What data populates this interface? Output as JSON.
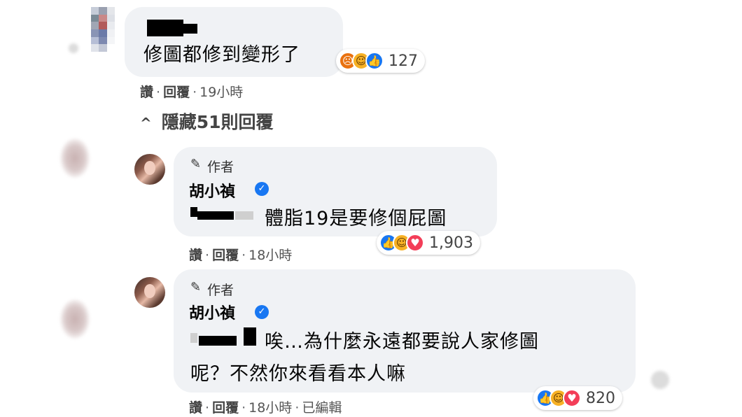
{
  "comments": {
    "top": {
      "text": "修圖都修到變形了",
      "reactions": {
        "icons": [
          "angry-icon",
          "haha-icon",
          "like-icon"
        ],
        "count": "127"
      },
      "actions": {
        "like": "讚",
        "reply": "回覆",
        "time": "19小時"
      }
    },
    "replies_toggle": {
      "chevron": "^",
      "label": "隱藏51則回覆"
    },
    "reply1": {
      "author_tag": "作者",
      "author_name": "胡小禎",
      "text": "體脂19是要修個屁圖",
      "reactions": {
        "icons": [
          "like-icon",
          "haha-icon",
          "love-icon"
        ],
        "count": "1,903"
      },
      "actions": {
        "like": "讚",
        "reply": "回覆",
        "time": "18小時"
      }
    },
    "reply2": {
      "author_tag": "作者",
      "author_name": "胡小禎",
      "text_line1": "唉…為什麼永遠都要說人家修圖",
      "text_line2": "呢？不然你來看看本人嘛",
      "reactions": {
        "icons": [
          "like-icon",
          "haha-icon",
          "love-icon"
        ],
        "count": "820"
      },
      "actions": {
        "like": "讚",
        "reply": "回覆",
        "time": "18小時",
        "edited": "已編輯"
      }
    }
  },
  "colors": {
    "bubble": "#f0f2f5",
    "like": "#1877f2",
    "haha": "#f7b125",
    "angry": "#e9710f",
    "love": "#f33e58",
    "verified": "#1877f2"
  }
}
